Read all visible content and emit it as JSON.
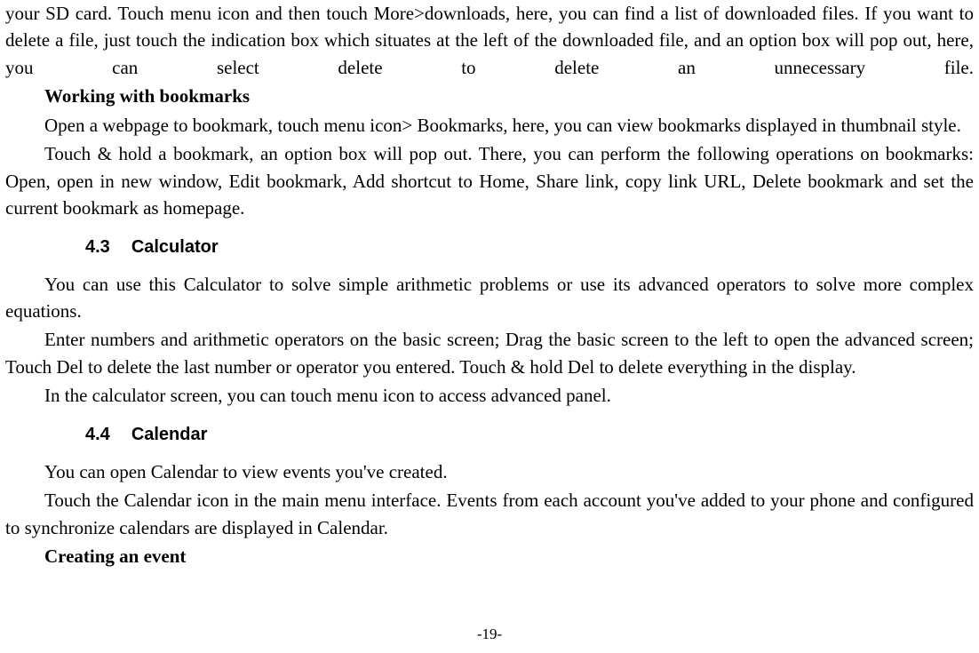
{
  "frag1": "your SD card. Touch menu icon and then touch More>downloads, here, you can find a list of downloaded files. If you want to delete a file, just touch the indication box which situates at the left of the downloaded file, and an option box will pop out, here, you can select delete to delete an unnecessary file.",
  "heading_bookmarks": "Working with bookmarks",
  "para_bookmarks_1": "Open a webpage to bookmark, touch menu icon> Bookmarks, here, you can view bookmarks displayed in thumbnail style.",
  "para_bookmarks_2": "Touch & hold a bookmark, an option box will pop out. There, you can perform the following operations on bookmarks: Open, open in new window, Edit bookmark, Add shortcut to Home, Share link, copy link URL, Delete bookmark and set the current bookmark as homepage.",
  "section_4_3_num": "4.3",
  "section_4_3_title": "Calculator",
  "para_calc_1": "You can use this Calculator to solve simple arithmetic problems or use its advanced operators to solve more complex equations.",
  "para_calc_2": "Enter numbers and arithmetic operators on the basic screen; Drag the basic screen to the left to open the advanced screen; Touch Del to delete the last number or operator you entered. Touch & hold Del to delete everything in the display.",
  "para_calc_3": "In the calculator screen, you can touch menu icon to access advanced panel.",
  "section_4_4_num": "4.4",
  "section_4_4_title": "Calendar",
  "para_cal_1": "You can open Calendar to view events you've created.",
  "para_cal_2": "Touch the Calendar icon in the main menu interface. Events from each account you've added to your phone and configured to synchronize calendars are displayed in Calendar.",
  "heading_event": "Creating an event",
  "page_number": "-19-"
}
